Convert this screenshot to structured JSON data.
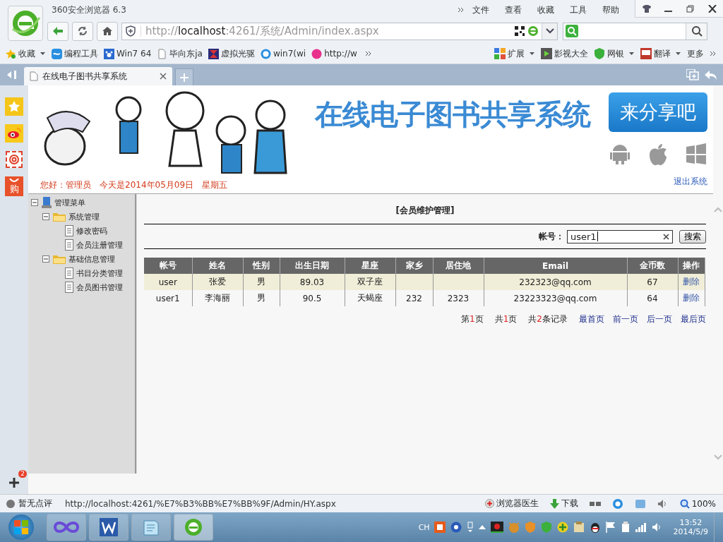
{
  "browser": {
    "title": "360安全浏览器 6.3",
    "menu": [
      "文件",
      "查看",
      "收藏",
      "工具",
      "帮助"
    ],
    "address": {
      "scheme": "http://",
      "host": "localhost",
      "rest": ":4261/系统/Admin/index.aspx"
    },
    "bookmarks": [
      {
        "label": "收藏",
        "kind": "star",
        "dropdown": true
      },
      {
        "label": "编程工具",
        "kind": "cloud",
        "dropdown": false
      },
      {
        "label": "Win7 64",
        "kind": "paw",
        "dropdown": false
      },
      {
        "label": "毕向东ja",
        "kind": "page",
        "dropdown": false
      },
      {
        "label": "虚拟光驱",
        "kind": "hourglass",
        "dropdown": false
      },
      {
        "label": "win7(wi",
        "kind": "globe",
        "dropdown": false
      },
      {
        "label": "http://w",
        "kind": "heart",
        "dropdown": false
      }
    ],
    "extensions": [
      {
        "label": "扩展",
        "kind": "blocks",
        "dropdown": true
      },
      {
        "label": "影视大全",
        "kind": "film",
        "dropdown": false
      },
      {
        "label": "网银",
        "kind": "shield",
        "dropdown": true
      },
      {
        "label": "翻译",
        "kind": "book",
        "dropdown": true
      },
      {
        "label": "更多",
        "kind": "more",
        "dropdown": false
      }
    ],
    "tabs": [
      {
        "label": "在线电子图书共享系统",
        "selected": true
      }
    ]
  },
  "side_dock": {
    "shop_label": "购",
    "badge": "2"
  },
  "page": {
    "site_title": "在线电子图书共享系统",
    "share_button": "来分享吧",
    "greeting": "您好：管理员",
    "date": "今天是2014年05月09日",
    "weekday": "星期五",
    "logout": "退出系统",
    "tree": [
      {
        "label": "管理菜单",
        "kind": "root",
        "expanded": true,
        "children": [
          {
            "label": "系统管理",
            "kind": "folder",
            "expanded": true,
            "children": [
              {
                "label": "修改密码",
                "kind": "page"
              },
              {
                "label": "会员注册管理",
                "kind": "page"
              }
            ]
          },
          {
            "label": "基础信息管理",
            "kind": "folder",
            "expanded": true,
            "children": [
              {
                "label": "书目分类管理",
                "kind": "page"
              },
              {
                "label": "会员图书管理",
                "kind": "page"
              }
            ]
          }
        ]
      }
    ],
    "panel_title": "[会员维护管理]",
    "search": {
      "label": "帐号：",
      "value": "user1",
      "button": "搜索"
    },
    "table": {
      "columns": [
        "帐号",
        "姓名",
        "性别",
        "出生日期",
        "星座",
        "家乡",
        "居住地",
        "Email",
        "金币数",
        "操作"
      ],
      "rows": [
        {
          "selected": true,
          "cells": [
            "user",
            "张爱",
            "男",
            "89.03",
            "双子座",
            "",
            "",
            "232323@qq.com",
            "67"
          ],
          "action": "删除"
        },
        {
          "selected": false,
          "cells": [
            "user1",
            "李海丽",
            "男",
            "90.5",
            "天蝎座",
            "232",
            "2323",
            "23223323@qq.com",
            "64"
          ],
          "action": "删除"
        }
      ]
    },
    "pager": {
      "stats": [
        {
          "before": "第",
          "number": "1",
          "after": "页"
        },
        {
          "before": "共",
          "number": "1",
          "after": "页"
        },
        {
          "before": "共",
          "number": "2",
          "after": "条记录"
        }
      ],
      "links": [
        "最首页",
        "前一页",
        "后一页",
        "最后页"
      ]
    }
  },
  "status_bar": {
    "rating": "暂无点评",
    "url": "http://localhost:4261/%E7%B3%BB%E7%BB%9F/Admin/HY.aspx",
    "doctor": "浏览器医生",
    "download": "下载",
    "zoom": "100%"
  },
  "taskbar": {
    "ime": "CH",
    "time": "13:52",
    "date": "2014/5/9"
  }
}
